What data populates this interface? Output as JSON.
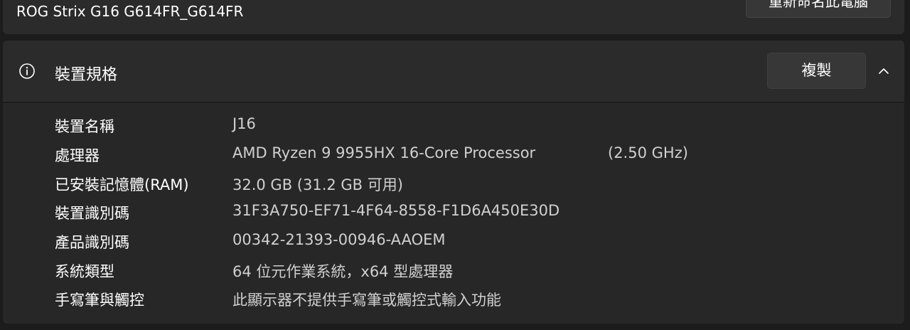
{
  "device_header": {
    "device_name": "ROG Strix G16 G614FR_G614FR",
    "rename_button_label": "重新命名此電腦"
  },
  "specs": {
    "title": "裝置規格",
    "copy_button_label": "複製",
    "icons": {
      "info": "info-icon",
      "collapse": "chevron-up-icon"
    },
    "rows": [
      {
        "label": "裝置名稱",
        "value": "J16"
      },
      {
        "label": "處理器",
        "value": "AMD Ryzen 9 9955HX 16-Core Processor",
        "extra": "(2.50 GHz)"
      },
      {
        "label": "已安裝記憶體(RAM)",
        "value": "32.0 GB (31.2 GB 可用)"
      },
      {
        "label": "裝置識別碼",
        "value": "31F3A750-EF71-4F64-8558-F1D6A450E30D"
      },
      {
        "label": "產品識別碼",
        "value": "00342-21393-00946-AAOEM"
      },
      {
        "label": "系統類型",
        "value": "64 位元作業系統，x64 型處理器"
      },
      {
        "label": "手寫筆與觸控",
        "value": "此顯示器不提供手寫筆或觸控式輸入功能"
      }
    ]
  },
  "colors": {
    "background": "#1c1c1c",
    "card": "#2b2b2b",
    "card_body": "#272727",
    "button": "#373737",
    "text_primary": "#ffffff",
    "text_secondary": "#d0d0d0"
  }
}
